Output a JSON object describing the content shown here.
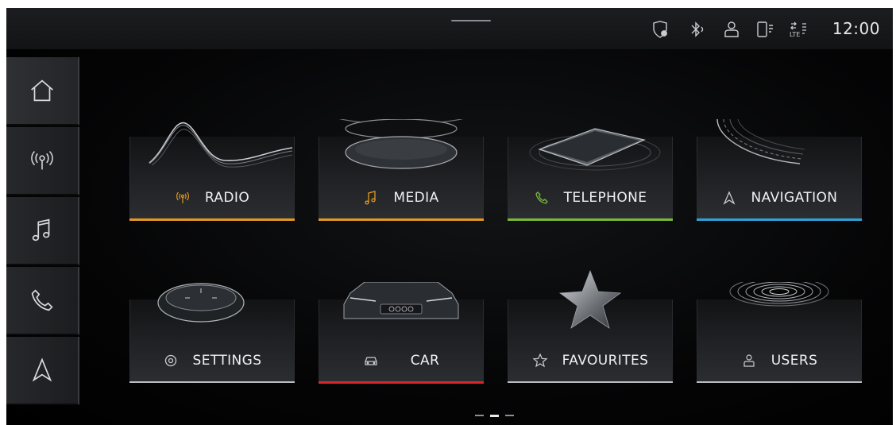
{
  "status_bar": {
    "icons": [
      "location-shield-icon",
      "bluetooth-icon",
      "user-icon",
      "phone-signal-icon",
      "lte-signal-icon"
    ],
    "time": "12:00"
  },
  "sidebar": {
    "items": [
      {
        "name": "home",
        "icon": "home-icon",
        "active": true
      },
      {
        "name": "radio",
        "icon": "radio-antenna-icon"
      },
      {
        "name": "media",
        "icon": "music-note-icon"
      },
      {
        "name": "telephone",
        "icon": "phone-icon"
      },
      {
        "name": "navigation",
        "icon": "navigation-arrow-icon"
      }
    ]
  },
  "tiles": [
    {
      "label": "RADIO",
      "icon": "radio-antenna-icon",
      "accent": "#e39a1f"
    },
    {
      "label": "MEDIA",
      "icon": "music-note-icon",
      "accent": "#e39a1f"
    },
    {
      "label": "TELEPHONE",
      "icon": "phone-icon",
      "accent": "#7ab83a"
    },
    {
      "label": "NAVIGATION",
      "icon": "navigation-arrow-icon",
      "accent": "#2fa3d6"
    },
    {
      "label": "SETTINGS",
      "icon": "gear-icon",
      "accent": "#b9bcc0"
    },
    {
      "label": "CAR",
      "icon": "car-icon",
      "accent": "#d8262b"
    },
    {
      "label": "FAVOURITES",
      "icon": "star-icon",
      "accent": "#b9bcc0"
    },
    {
      "label": "USERS",
      "icon": "user-icon",
      "accent": "#b9bcc0"
    }
  ],
  "pager": {
    "pages": 3,
    "current": 2
  }
}
